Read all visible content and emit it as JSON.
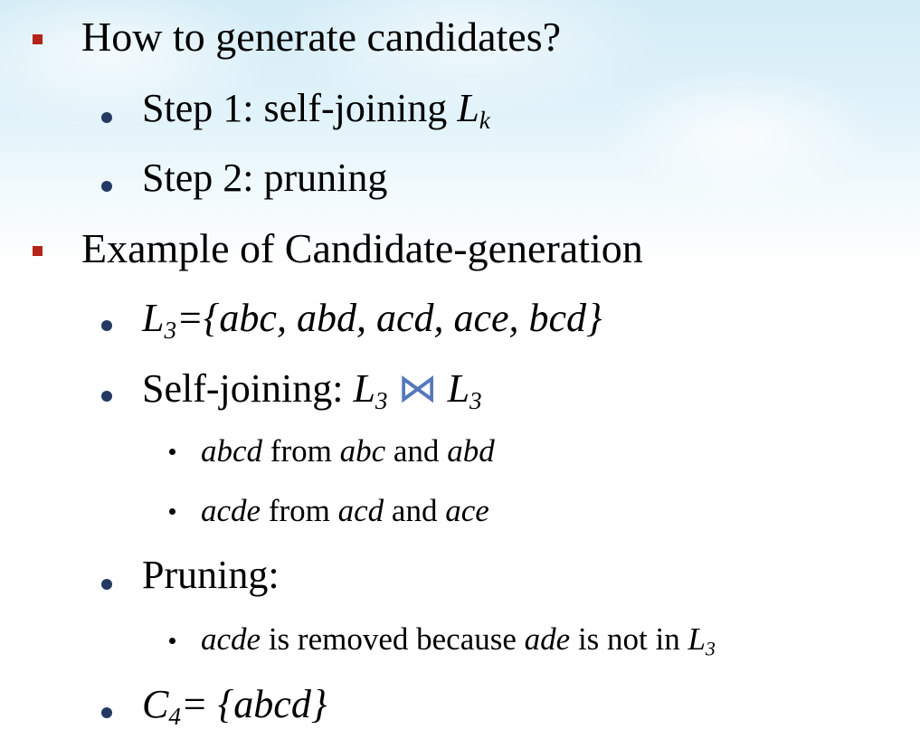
{
  "slide": {
    "items": [
      {
        "level": 1,
        "text": "How to generate candidates?"
      },
      {
        "level": 2,
        "text": "Step 1: self-joining ",
        "math": "L",
        "sub": "k"
      },
      {
        "level": 2,
        "text": "Step 2: pruning"
      },
      {
        "level": 1,
        "text": "Example of Candidate-generation"
      },
      {
        "level": 2,
        "math": "L",
        "sub": "3",
        "rest": "={abc, abd, acd, ace, bcd}"
      },
      {
        "level": 2,
        "text": "Self-joining: ",
        "math": "L",
        "sub": "3",
        "join": "⋈",
        "math2": "L",
        "sub2": "3"
      },
      {
        "level": 3,
        "a": "abcd",
        "b": " from ",
        "c": "abc",
        "d": " and ",
        "e": "abd"
      },
      {
        "level": 3,
        "a": "acde",
        "b": " from ",
        "c": "acd",
        "d": " and ",
        "e": "ace"
      },
      {
        "level": 2,
        "text": "Pruning:"
      },
      {
        "level": 3,
        "a": "acde",
        "b": " is removed because ",
        "c": "ade",
        "d": " is not in ",
        "math": "L",
        "sub": "3"
      },
      {
        "level": 2,
        "math": "C",
        "sub": "4",
        "rest": "= {abcd}"
      }
    ]
  },
  "colors": {
    "level1_bullet": "#b22418",
    "level2_bullet": "#243a63",
    "join_symbol": "#5577bb"
  }
}
